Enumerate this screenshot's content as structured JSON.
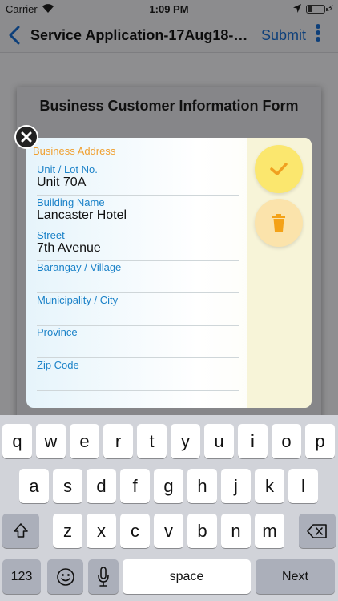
{
  "status_bar": {
    "carrier": "Carrier",
    "time": "1:09 PM"
  },
  "nav_bar": {
    "title": "Service Application-17Aug18-13...",
    "submit_label": "Submit"
  },
  "background_form": {
    "heading": "Business Customer Information Form"
  },
  "modal": {
    "section_title": "Business Address",
    "fields": [
      {
        "label": "Unit / Lot No.",
        "value": "Unit 70A"
      },
      {
        "label": "Building Name",
        "value": "Lancaster Hotel"
      },
      {
        "label": "Street",
        "value": "7th Avenue"
      },
      {
        "label": "Barangay / Village",
        "value": ""
      },
      {
        "label": "Municipality / City",
        "value": ""
      },
      {
        "label": "Province",
        "value": ""
      },
      {
        "label": "Zip Code",
        "value": ""
      }
    ]
  },
  "keyboard": {
    "row1": [
      "q",
      "w",
      "e",
      "r",
      "t",
      "y",
      "u",
      "i",
      "o",
      "p"
    ],
    "row2": [
      "a",
      "s",
      "d",
      "f",
      "g",
      "h",
      "j",
      "k",
      "l"
    ],
    "row3": [
      "z",
      "x",
      "c",
      "v",
      "b",
      "n",
      "m"
    ],
    "numbers_label": "123",
    "space_label": "space",
    "next_label": "Next"
  },
  "colors": {
    "accent_blue": "#1b82c8",
    "section_orange": "#f0a030",
    "confirm_yellow": "#fbe76e",
    "delete_orange": "#f4a217"
  },
  "icons": [
    "wifi-icon",
    "location-icon",
    "battery-icon",
    "back-chevron-icon",
    "more-vertical-icon",
    "checkmark-icon",
    "trash-icon",
    "close-icon",
    "shift-icon",
    "emoji-icon",
    "microphone-icon",
    "backspace-icon"
  ]
}
